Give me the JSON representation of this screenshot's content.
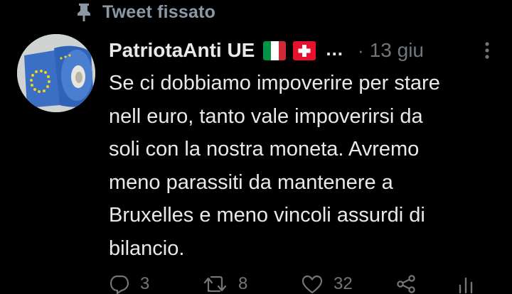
{
  "pinned": {
    "label": "Tweet fissato",
    "icon": "pin-icon"
  },
  "author": {
    "display_name": "PatriotaAnti UE",
    "flags": [
      "italy-flag-emoji",
      "switzerland-flag-emoji"
    ],
    "ellipsis": "...",
    "separator": "·",
    "timestamp": "13 giu"
  },
  "tweet": {
    "lines": [
      "Se ci dobbiamo impoverire per stare",
      "nell euro, tanto vale impoverirsi da",
      "soli con la nostra moneta. Avremo",
      "meno parassiti da mantenere a",
      "Bruxelles e meno vincoli assurdi di",
      "bilancio."
    ]
  },
  "actions": {
    "reply": {
      "icon": "reply-icon",
      "count": "3"
    },
    "retweet": {
      "icon": "retweet-icon",
      "count": "8"
    },
    "like": {
      "icon": "heart-icon",
      "count": "32"
    },
    "share": {
      "icon": "share-icon"
    },
    "analytics": {
      "icon": "analytics-icon"
    }
  },
  "colors": {
    "background": "#000000",
    "primary_text": "#e7e9ea",
    "secondary_text": "#71767b",
    "eu_blue": "#3a6fc4",
    "eu_star": "#f2d21b"
  }
}
